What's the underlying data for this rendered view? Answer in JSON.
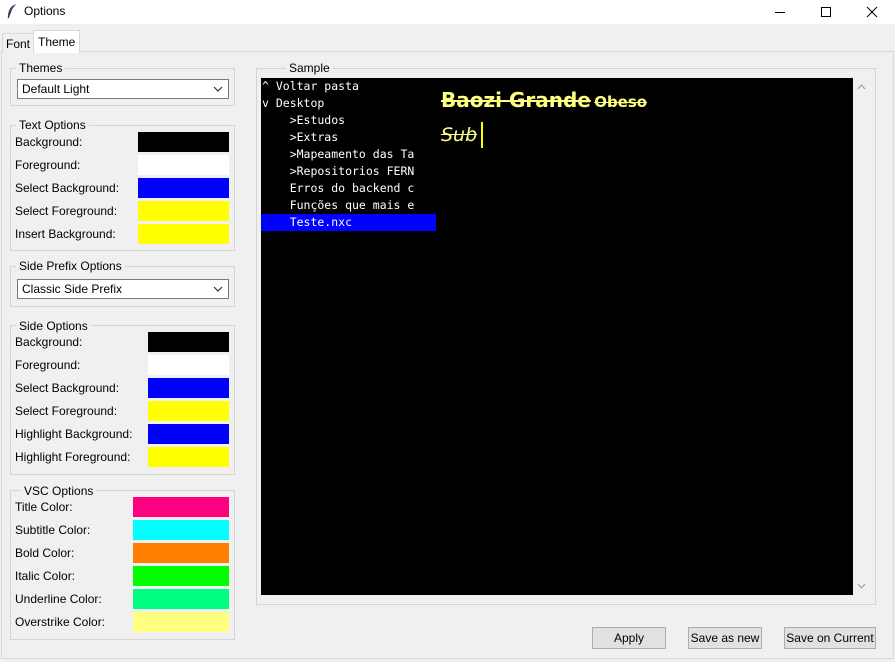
{
  "window": {
    "title": "Options"
  },
  "tabs": [
    {
      "label": "Font"
    },
    {
      "label": "Theme"
    }
  ],
  "themes": {
    "legend": "Themes",
    "selected": "Default Light"
  },
  "text_options": {
    "legend": "Text Options",
    "rows": [
      {
        "label": "Background:",
        "color": "#000000"
      },
      {
        "label": "Foreground:",
        "color": "#ffffff"
      },
      {
        "label": "Select Background:",
        "color": "#0000ff"
      },
      {
        "label": "Select Foreground:",
        "color": "#ffff00"
      },
      {
        "label": "Insert Background:",
        "color": "#ffff00"
      }
    ]
  },
  "side_prefix": {
    "legend": "Side Prefix Options",
    "selected": "Classic Side Prefix"
  },
  "side_options": {
    "legend": "Side Options",
    "rows": [
      {
        "label": "Background:",
        "color": "#000000"
      },
      {
        "label": "Foreground:",
        "color": "#ffffff"
      },
      {
        "label": "Select Background:",
        "color": "#0000ff"
      },
      {
        "label": "Select Foreground:",
        "color": "#ffff00"
      },
      {
        "label": "Highlight Background:",
        "color": "#0000ff"
      },
      {
        "label": "Highlight Foreground:",
        "color": "#ffff00"
      }
    ]
  },
  "vsc_options": {
    "legend": "VSC Options",
    "rows": [
      {
        "label": "Title Color:",
        "color": "#ff0080"
      },
      {
        "label": "Subtitle Color:",
        "color": "#00ffff"
      },
      {
        "label": "Bold Color:",
        "color": "#ff8000"
      },
      {
        "label": "Italic Color:",
        "color": "#00ff00"
      },
      {
        "label": "Underline Color:",
        "color": "#00ff80"
      },
      {
        "label": "Overstrike Color:",
        "color": "#ffff80"
      }
    ]
  },
  "sample": {
    "legend": "Sample",
    "tree": [
      {
        "text": "^ Voltar pasta",
        "selected": false
      },
      {
        "text": "v Desktop",
        "selected": false
      },
      {
        "text": "    >Estudos",
        "selected": false
      },
      {
        "text": "    >Extras",
        "selected": false
      },
      {
        "text": "    >Mapeamento das Ta",
        "selected": false
      },
      {
        "text": "    >Repositorios FERN",
        "selected": false
      },
      {
        "text": "    Erros do backend c",
        "selected": false
      },
      {
        "text": "    Funções que mais e",
        "selected": false
      },
      {
        "text": "    Teste.nxc",
        "selected": true
      }
    ],
    "title_text": "Baozi Grande",
    "title_small": "Obeso",
    "sub_text": "Sub",
    "text_color": "#ffff80"
  },
  "buttons": {
    "apply": "Apply",
    "save_new": "Save as new",
    "save_current": "Save on Current"
  }
}
